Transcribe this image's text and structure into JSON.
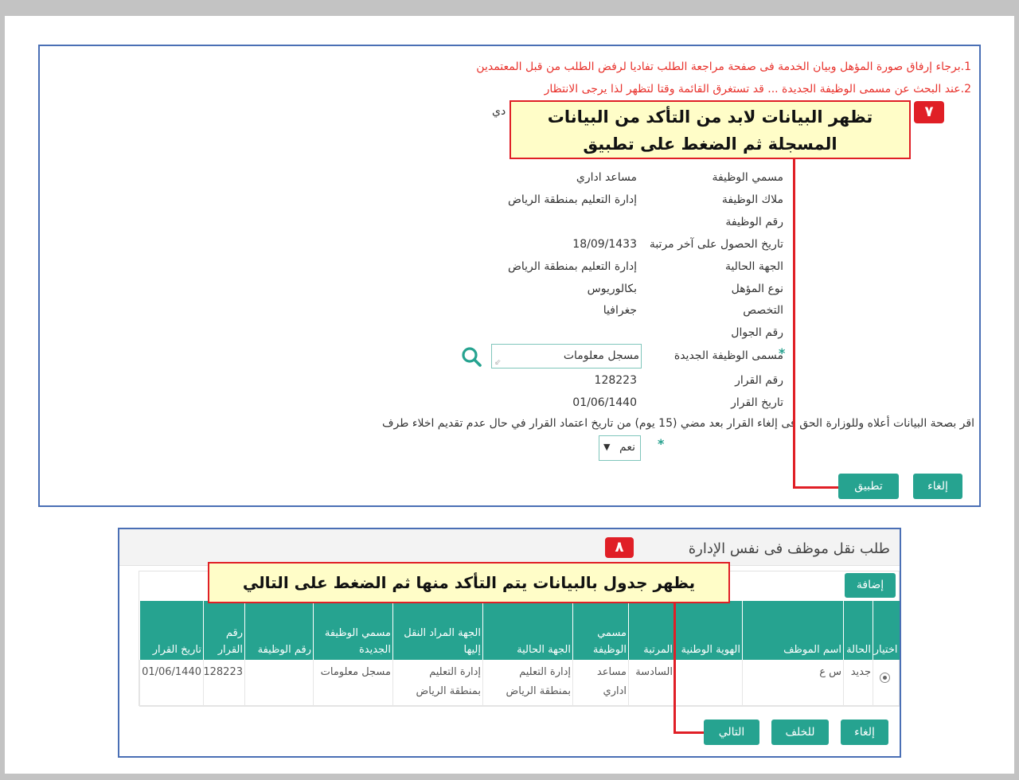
{
  "panel1": {
    "notes": [
      "1.برجاء إرفاق صورة المؤهل وبيان الخدمة فى صفحة مراجعة الطلب تفاديا لرفض الطلب من قبل المعتمدين",
      "2.عند البحث عن مسمى الوظيفة الجديدة ... قد تستغرق القائمة وقتا لتظهر لذا يرجى الانتظار"
    ],
    "partial_text": "دي",
    "fields": [
      {
        "label": "مسمي الوظيفة",
        "value": "مساعد اداري"
      },
      {
        "label": "ملاك الوظيفة",
        "value": "إدارة التعليم بمنطقة الرياض"
      },
      {
        "label": "رقم الوظيفة",
        "value": ""
      },
      {
        "label": "تاريخ الحصول على آخر مرتبة",
        "value": "18/09/1433"
      },
      {
        "label": "الجهة الحالية",
        "value": "إدارة التعليم بمنطقة الرياض"
      },
      {
        "label": "نوع المؤهل",
        "value": "بكالوريوس"
      },
      {
        "label": "التخصص",
        "value": "جغرافيا"
      },
      {
        "label": "رقم الجوال",
        "value": ""
      }
    ],
    "new_job": {
      "label": "مسمى الوظيفة الجديدة",
      "value": "مسجل معلومات",
      "required": "*"
    },
    "decision_number": {
      "label": "رقم القرار",
      "value": "128223"
    },
    "decision_date": {
      "label": "تاريخ القرار",
      "value": "01/06/1440"
    },
    "declaration": "اقر بصحة البيانات أعلاه وللوزارة الحق فى إلغاء القرار بعد مضي (15 يوم) من تاريخ اعتماد القرار في حال عدم تقديم اخلاء طرف",
    "agree_select": {
      "value": "نعم",
      "required": "*"
    },
    "buttons": {
      "cancel": "إلغاء",
      "apply": "تطبيق"
    },
    "callout": {
      "line1": "تظهر البيانات لابد من التأكد من البيانات",
      "line2": "المسجلة ثم الضغط على تطبيق",
      "badge": "٧"
    }
  },
  "panel2": {
    "title": "طلب نقل موظف فى نفس الإدارة",
    "badge": "٨",
    "add_button": "إضافة",
    "callout": "يظهر جدول بالبيانات يتم التأكد منها ثم الضغط على التالي",
    "table": {
      "headers": [
        "اختيار",
        "الحالة",
        "اسم الموظف",
        "الهوية الوطنية",
        "المرتبة",
        "مسمي الوظيفة",
        "الجهة الحالية",
        "الجهة المراد النقل إليها",
        "مسمي الوظيفة الجديدة",
        "رقم الوظيفة",
        "رقم القرار",
        "تاريخ القرار"
      ],
      "rows": [
        [
          "",
          "جديد",
          "س ع",
          "",
          "السادسة",
          "مساعد اداري",
          "إدارة التعليم بمنطقة الرياض",
          "إدارة التعليم بمنطقة الرياض",
          "مسجل معلومات",
          "",
          "128223",
          "01/06/1440"
        ]
      ]
    },
    "buttons": {
      "cancel": "إلغاء",
      "back": "للخلف",
      "next": "التالي"
    }
  },
  "colors": {
    "accent": "#26a390",
    "callout_border": "#e01f26",
    "callout_bg": "#fffdc8",
    "panel_border": "#4a6fb5",
    "note_text": "#e8322c"
  }
}
